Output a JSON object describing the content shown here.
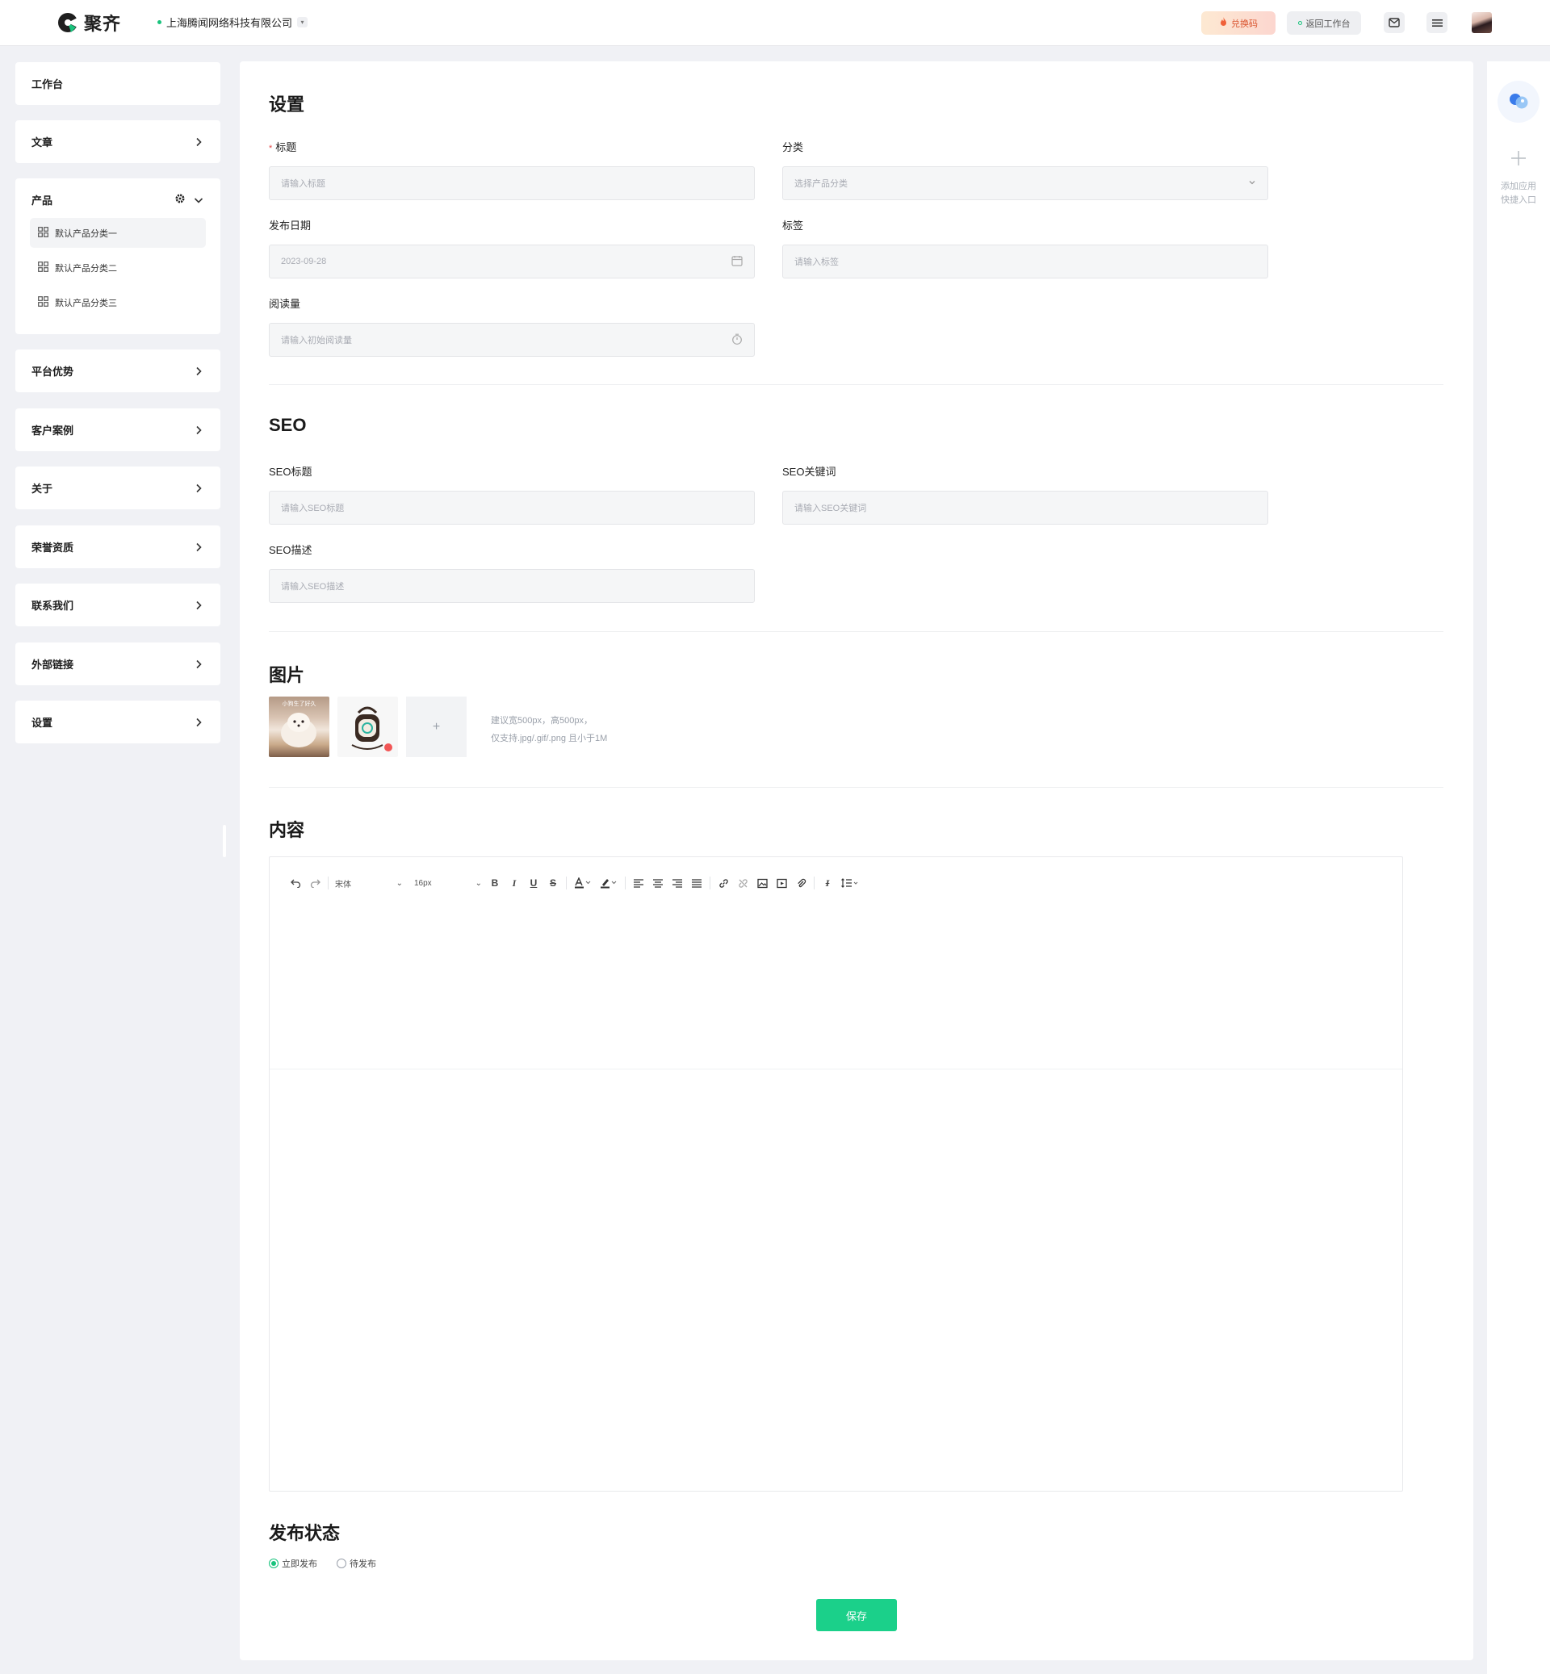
{
  "app": {
    "name": "聚齐",
    "company": "上海腾闻网络科技有限公司"
  },
  "header": {
    "redeem_label": "兑换码",
    "back_label": "返回工作台"
  },
  "sidebar": {
    "workbench": "工作台",
    "items": [
      {
        "label": "文章"
      },
      {
        "label": "产品",
        "expanded": true
      },
      {
        "label": "平台优势"
      },
      {
        "label": "客户案例"
      },
      {
        "label": "关于"
      },
      {
        "label": "荣誉资质"
      },
      {
        "label": "联系我们"
      },
      {
        "label": "外部链接"
      },
      {
        "label": "设置"
      }
    ],
    "product_sub": [
      "默认产品分类一",
      "默认产品分类二",
      "默认产品分类三"
    ]
  },
  "settings": {
    "title": "设置",
    "title_label": "标题",
    "title_placeholder": "请输入标题",
    "category_label": "分类",
    "category_placeholder": "选择产品分类",
    "date_label": "发布日期",
    "date_value": "2023-09-28",
    "tags_label": "标签",
    "tags_placeholder": "请输入标签",
    "views_label": "阅读量",
    "views_placeholder": "请输入初始阅读量"
  },
  "seo": {
    "title": "SEO",
    "seo_title_label": "SEO标题",
    "seo_title_placeholder": "请输入SEO标题",
    "seo_keywords_label": "SEO关键词",
    "seo_keywords_placeholder": "请输入SEO关键词",
    "seo_desc_label": "SEO描述",
    "seo_desc_placeholder": "请输入SEO描述"
  },
  "images": {
    "title": "图片",
    "thumb1_caption": "小狗生了好久",
    "upload_symbol": "+",
    "hint_line1": "建议宽500px，高500px，",
    "hint_line2": "仅支持.jpg/.gif/.png 且小于1M"
  },
  "content": {
    "title": "内容",
    "font_family": "宋体",
    "font_size": "16px"
  },
  "publish": {
    "title": "发布状态",
    "option_now": "立即发布",
    "option_pending": "待发布",
    "selected": "立即发布",
    "save_label": "保存"
  },
  "rail": {
    "add_line1": "添加应用",
    "add_line2": "快捷入口"
  },
  "colors": {
    "accent": "#1bd08a",
    "required": "#e24b4b",
    "redeem": "#d9542e"
  }
}
